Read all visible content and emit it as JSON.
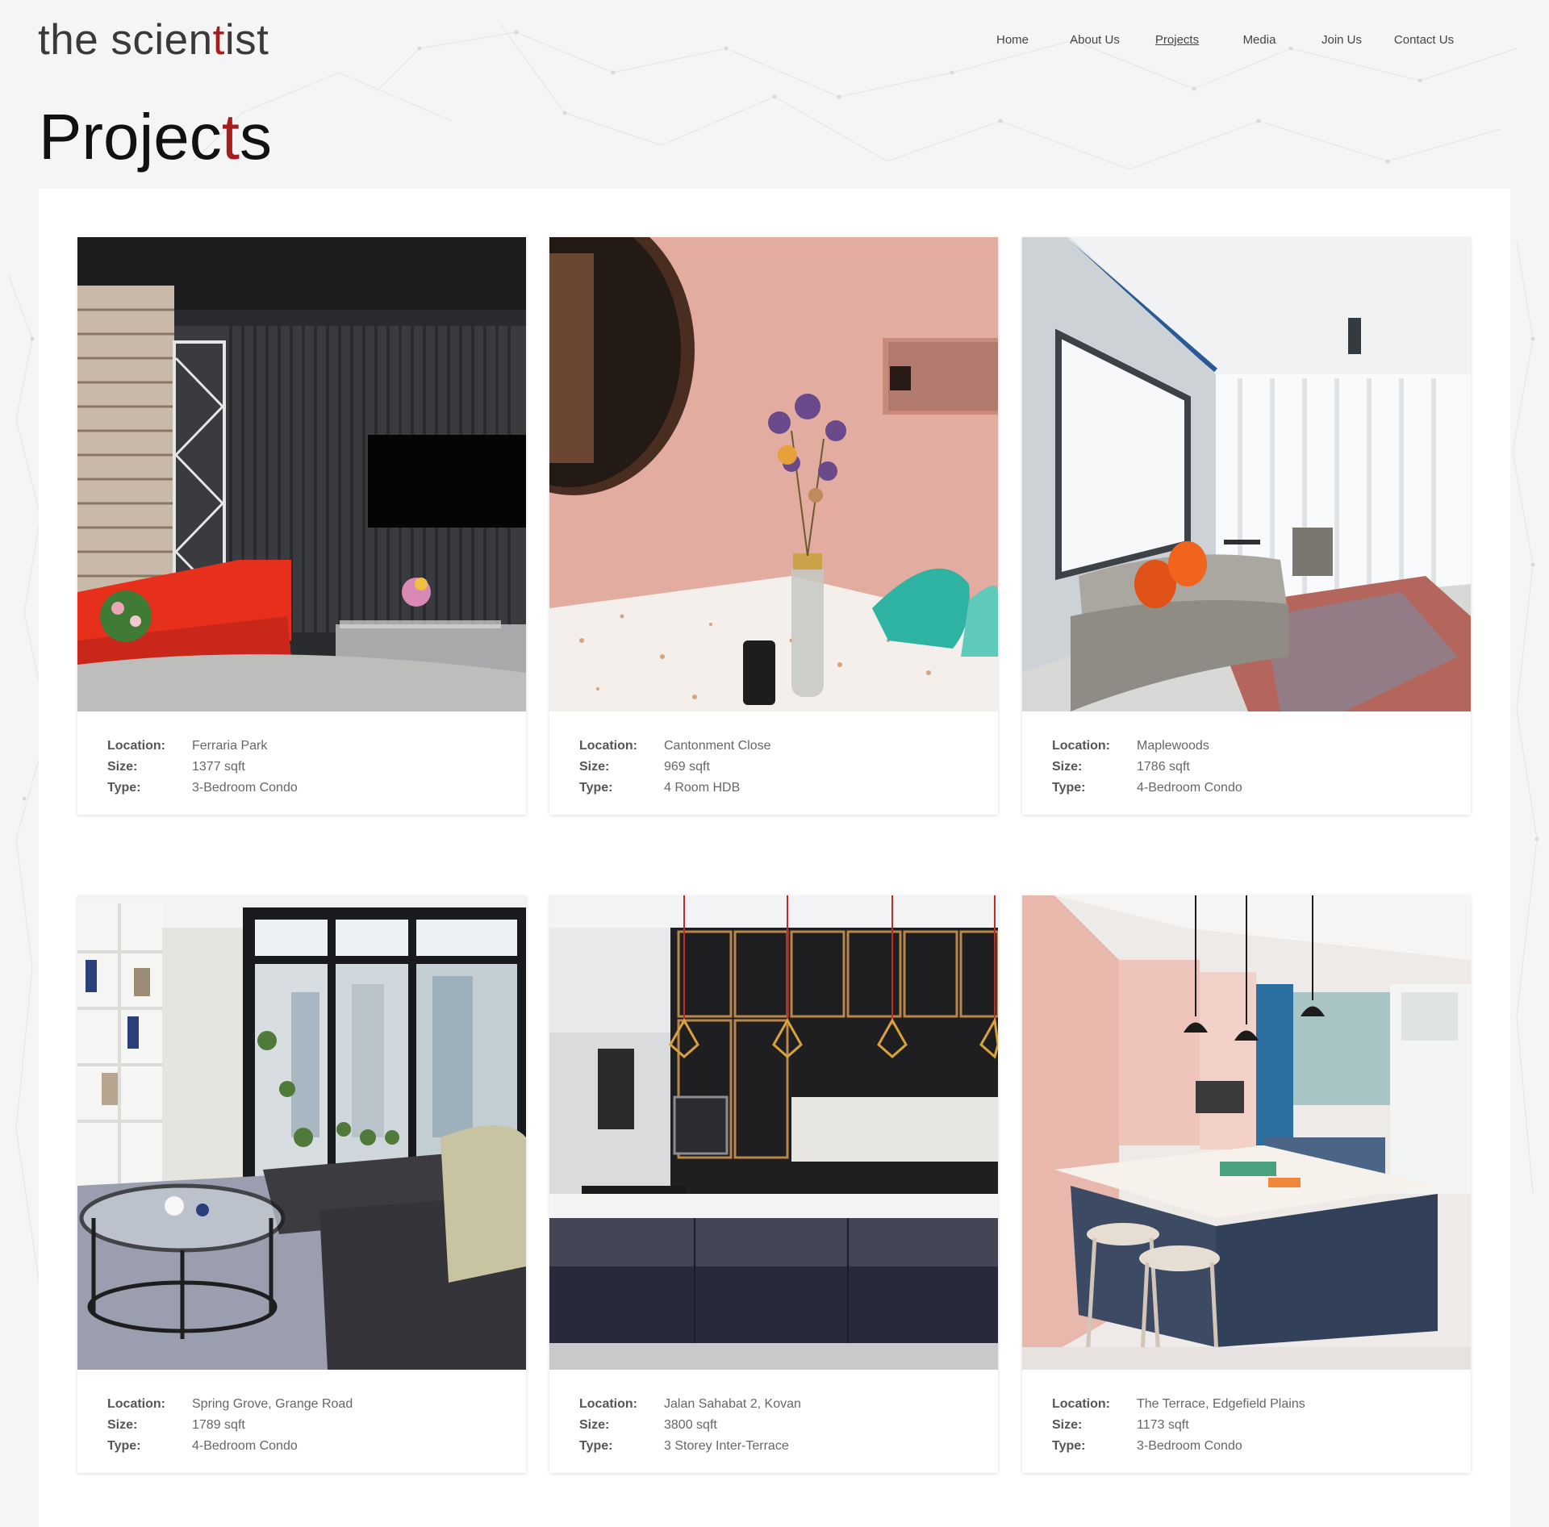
{
  "brand": {
    "logo_pre": "the scien",
    "logo_accent": "t",
    "logo_post": "ist"
  },
  "nav": {
    "home": "Home",
    "about": "About Us",
    "projects": "Projects",
    "media": "Media",
    "join": "Join Us",
    "contact": "Contact Us",
    "active": "Projects"
  },
  "page": {
    "title_pre": "Projec",
    "title_accent": "t",
    "title_post": "s"
  },
  "labels": {
    "location": "Location:",
    "size": "Size:",
    "type": "Type:"
  },
  "projects": [
    {
      "location": "Ferraria Park",
      "size": "1377 sqft",
      "type": "3-Bedroom Condo"
    },
    {
      "location": "Cantonment Close",
      "size": "969 sqft",
      "type": "4 Room HDB"
    },
    {
      "location": "Maplewoods",
      "size": "1786 sqft",
      "type": "4-Bedroom Condo"
    },
    {
      "location": "Spring Grove, Grange Road",
      "size": "1789 sqft",
      "type": "4-Bedroom Condo"
    },
    {
      "location": "Jalan Sahabat 2, Kovan",
      "size": "3800 sqft",
      "type": "3 Storey Inter-Terrace"
    },
    {
      "location": "The Terrace, Edgefield Plains",
      "size": "1173 sqft",
      "type": "3-Bedroom Condo"
    }
  ],
  "colors": {
    "accent": "#a51d1d",
    "background": "#f5f5f6",
    "panel": "#ffffff"
  }
}
